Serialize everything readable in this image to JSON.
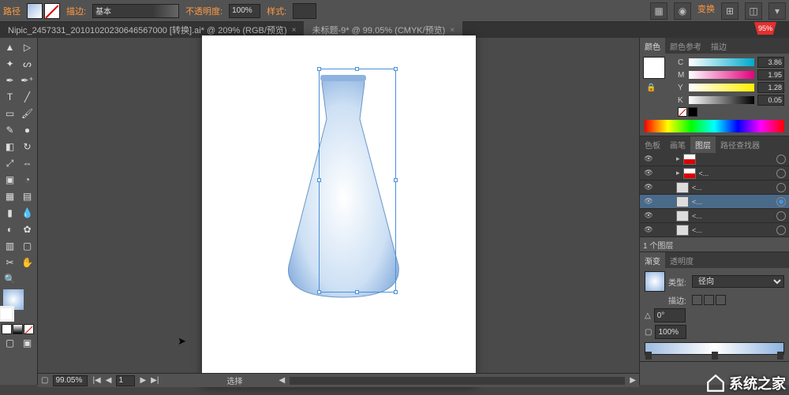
{
  "top_options": {
    "path_label": "路径",
    "stroke_label": "描边:",
    "stroke_weight": "基本",
    "opacity_label": "不透明度:",
    "opacity_value": "100%",
    "style_label": "样式:",
    "transform_label": "变换"
  },
  "tabs": [
    {
      "label": "Nipic_2457331_20101020230646567000 [转换].ai* @ 209% (RGB/预览)",
      "active": false
    },
    {
      "label": "未标题-9* @ 99.05% (CMYK/预览)",
      "active": true
    }
  ],
  "status": {
    "zoom": "99.05%",
    "page": "1",
    "select_label": "选择"
  },
  "panels": {
    "color": {
      "tabs": [
        "颜色",
        "颜色参考",
        "描边"
      ],
      "cmyk": [
        {
          "ch": "C",
          "value": "3.86"
        },
        {
          "ch": "M",
          "value": "1.95"
        },
        {
          "ch": "Y",
          "value": "1.28"
        },
        {
          "ch": "K",
          "value": "0.05"
        }
      ]
    },
    "layers": {
      "tabs": [
        "色板",
        "画笔",
        "图层",
        "路径查找器"
      ],
      "rows": [
        {
          "name": "",
          "thumb": "red"
        },
        {
          "name": "<...",
          "thumb": "red"
        },
        {
          "name": "<...",
          "thumb": "gray"
        },
        {
          "name": "<...",
          "thumb": "gray"
        },
        {
          "name": "<...",
          "thumb": "gray"
        },
        {
          "name": "<...",
          "thumb": "gray"
        }
      ],
      "footer": "1 个图层"
    },
    "gradient": {
      "tabs": [
        "渐变",
        "透明度"
      ],
      "type_label": "类型:",
      "type_value": "径向",
      "stroke_label": "描边:",
      "angle_value": "0°",
      "opacity_value": "100%"
    }
  },
  "badge": "95%",
  "watermark": "系统之家"
}
